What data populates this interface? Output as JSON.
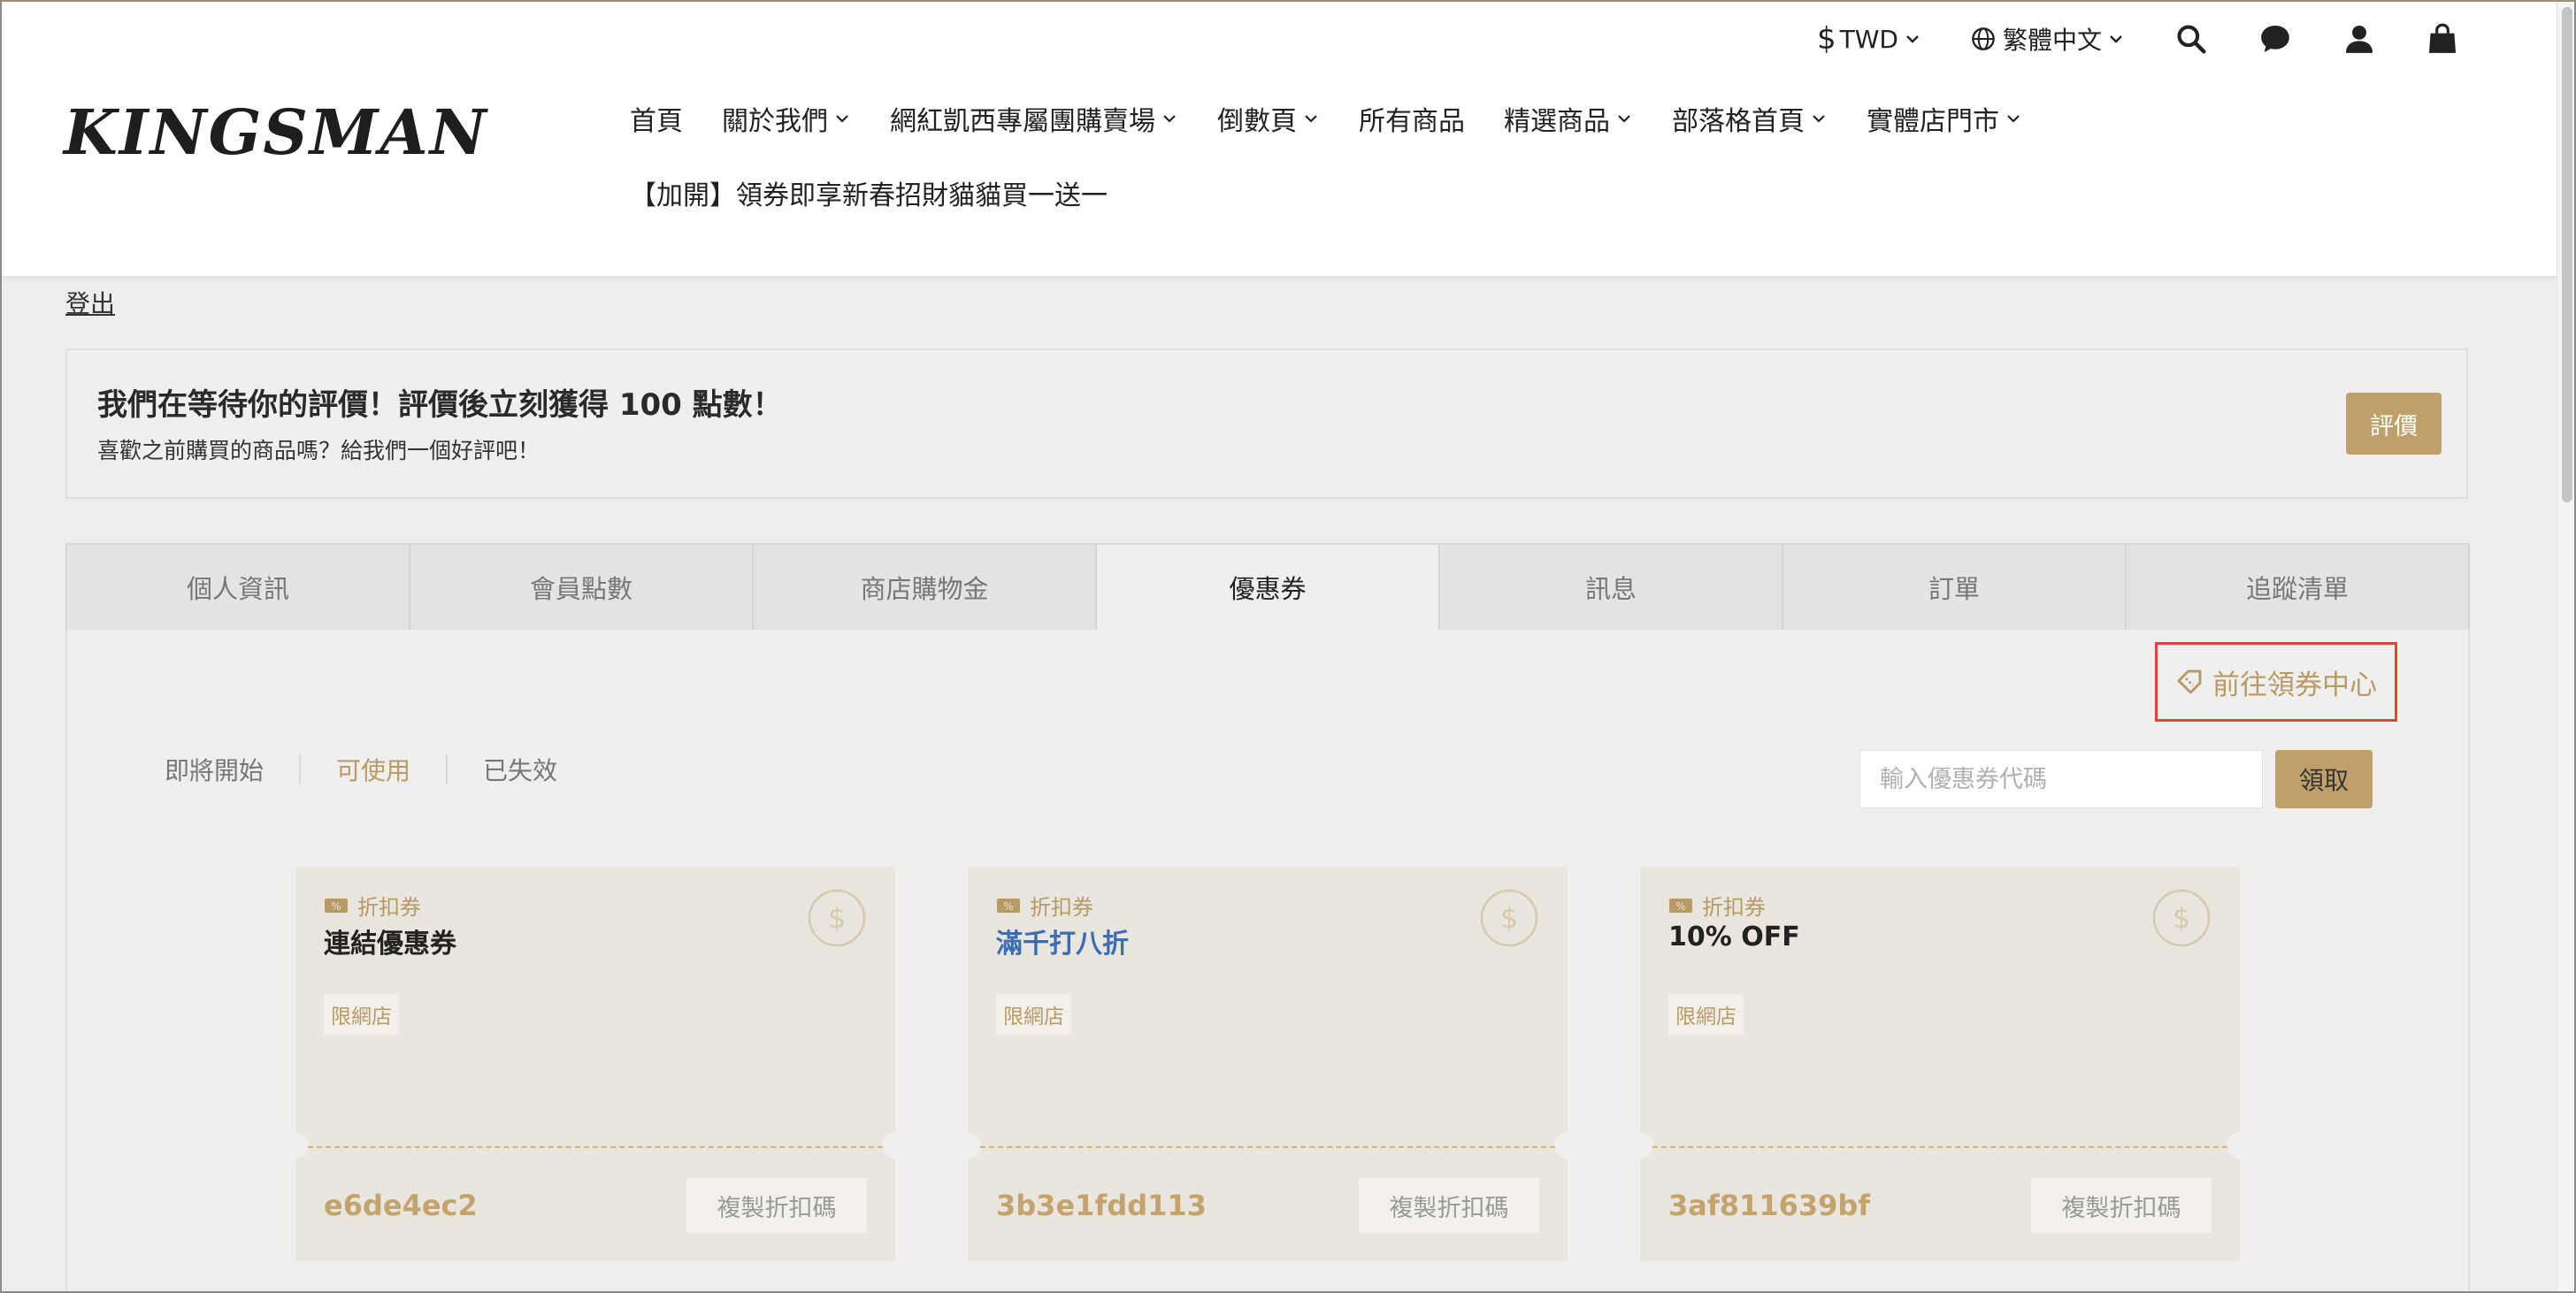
{
  "brand": {
    "logo": "KINGSMAN"
  },
  "topbar": {
    "currency": "TWD",
    "language": "繁體中文"
  },
  "nav": {
    "items": [
      {
        "label": "首頁",
        "has_dropdown": false
      },
      {
        "label": "關於我們",
        "has_dropdown": true
      },
      {
        "label": "網紅凱西專屬團購賣場",
        "has_dropdown": true
      },
      {
        "label": "倒數頁",
        "has_dropdown": true
      },
      {
        "label": "所有商品",
        "has_dropdown": false
      },
      {
        "label": "精選商品",
        "has_dropdown": true
      },
      {
        "label": "部落格首頁",
        "has_dropdown": true
      },
      {
        "label": "實體店門市",
        "has_dropdown": true
      }
    ],
    "promo": "【加開】領券即享新春招財貓貓買一送一"
  },
  "account": {
    "logout": "登出"
  },
  "review": {
    "title": "我們在等待你的評價！評價後立刻獲得 100 點數！",
    "subtitle": "喜歡之前購買的商品嗎？給我們一個好評吧！",
    "button": "評價"
  },
  "tabs": [
    {
      "label": "個人資訊",
      "active": false
    },
    {
      "label": "會員點數",
      "active": false
    },
    {
      "label": "商店購物金",
      "active": false
    },
    {
      "label": "優惠券",
      "active": true
    },
    {
      "label": "訊息",
      "active": false
    },
    {
      "label": "訂單",
      "active": false
    },
    {
      "label": "追蹤清單",
      "active": false
    }
  ],
  "coupon_page": {
    "center_link": "前往領券中心",
    "filters": [
      {
        "label": "即將開始",
        "active": false
      },
      {
        "label": "可使用",
        "active": true
      },
      {
        "label": "已失效",
        "active": false
      }
    ],
    "code_input_placeholder": "輸入優惠券代碼",
    "claim_button": "領取"
  },
  "coupons": [
    {
      "type": "折扣券",
      "name": "連結優惠券",
      "is_link": false,
      "tag": "限網店",
      "code": "e6de4ec2",
      "copy": "複製折扣碼"
    },
    {
      "type": "折扣券",
      "name": "滿千打八折",
      "is_link": true,
      "tag": "限網店",
      "code": "3b3e1fdd113",
      "copy": "複製折扣碼"
    },
    {
      "type": "折扣券",
      "name": "10% OFF",
      "is_link": false,
      "tag": "限網店",
      "code": "3af811639bf",
      "copy": "複製折扣碼"
    }
  ],
  "colors": {
    "accent": "#bfa06a",
    "highlight_border": "#e2452f",
    "link": "#3b6db4"
  }
}
